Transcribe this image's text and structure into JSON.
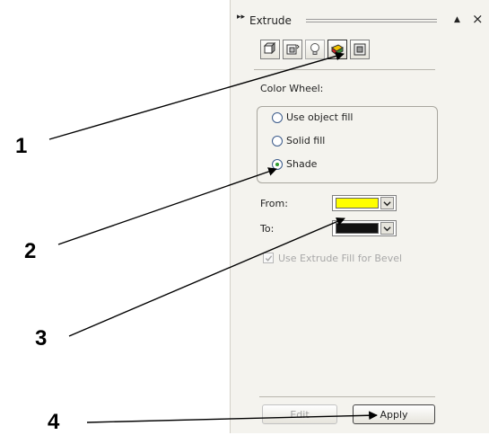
{
  "panel": {
    "title": "Extrude",
    "collapse_glyph": "▸▸",
    "minimize_glyph": "▲",
    "close_glyph": "×"
  },
  "toolbar": {
    "buttons": [
      {
        "icon": "extrude-camera-icon"
      },
      {
        "icon": "extrude-rotation-icon"
      },
      {
        "icon": "extrude-lighting-icon"
      },
      {
        "icon": "extrude-color-icon",
        "active": true
      },
      {
        "icon": "extrude-bevel-icon"
      }
    ]
  },
  "color_section": {
    "label": "Color Wheel:",
    "options": [
      {
        "label": "Use object fill",
        "checked": false
      },
      {
        "label": "Solid fill",
        "checked": false
      },
      {
        "label": "Shade",
        "checked": true
      }
    ]
  },
  "from": {
    "label": "From:",
    "color": "#ffff00"
  },
  "to": {
    "label": "To:",
    "color": "#111111"
  },
  "bevel": {
    "label": "Use Extrude Fill for Bevel",
    "checked": true,
    "enabled": false
  },
  "buttons": {
    "edit": "Edit",
    "apply": "Apply"
  },
  "callouts": [
    "1",
    "2",
    "3",
    "4"
  ]
}
